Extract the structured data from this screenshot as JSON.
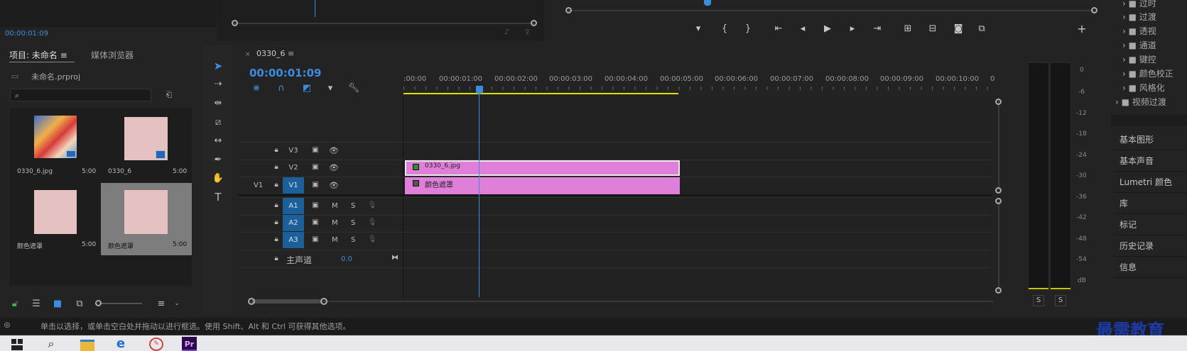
{
  "source": {
    "timecode": "00:00:01:09"
  },
  "project": {
    "tab_project": "项目: 未命名",
    "tab_media": "媒体浏览器",
    "file": "未命名.prproj",
    "items": [
      {
        "name": "0330_6.jpg",
        "dur": "5:00"
      },
      {
        "name": "0330_6",
        "dur": "5:00"
      },
      {
        "name": "颜色遮罩",
        "dur": "5:00"
      },
      {
        "name": "颜色遮罩",
        "dur": "5:00"
      }
    ]
  },
  "timeline": {
    "seq": "0330_6",
    "timecode": "00:00:01:09",
    "ruler": [
      ":00:00",
      "00:00:01:00",
      "00:00:02:00",
      "00:00:03:00",
      "00:00:04:00",
      "00:00:05:00",
      "00:00:06:00",
      "00:00:07:00",
      "00:00:08:00",
      "00:00:09:00",
      "00:00:10:00",
      "0"
    ],
    "tracks": {
      "v3": "V3",
      "v2": "V2",
      "v1": "V1",
      "src_v1": "V1",
      "a1": "A1",
      "a2": "A2",
      "a3": "A3",
      "m": "M",
      "s": "S",
      "master": "主声道",
      "master_val": "0.0"
    },
    "clips": {
      "v2": "0330_6.jpg",
      "v1": "颜色遮罩"
    }
  },
  "effects": [
    "过时",
    "过渡",
    "透视",
    "通道",
    "键控",
    "颜色校正",
    "风格化",
    "视频过渡"
  ],
  "right_panels": [
    "基本图形",
    "基本声音",
    "Lumetri 颜色",
    "库",
    "标记",
    "历史记录",
    "信息"
  ],
  "meter": {
    "scale": [
      "0",
      "-6",
      "-12",
      "-18",
      "-24",
      "-30",
      "-36",
      "-42",
      "-48",
      "-54",
      "dB"
    ],
    "solo_l": "S",
    "solo_r": "S"
  },
  "status": "单击以选择，或单击空白处并拖动以进行框选。使用 Shift、Alt 和 Ctrl 可获得其他选项。",
  "watermark": "最需教育",
  "taskbar": {
    "pr": "Pr"
  },
  "colors": {
    "accent": "#3b8de0",
    "clip_pink": "#e07fd9",
    "matte": "#e6c1c1",
    "work_area": "#e3e000"
  }
}
